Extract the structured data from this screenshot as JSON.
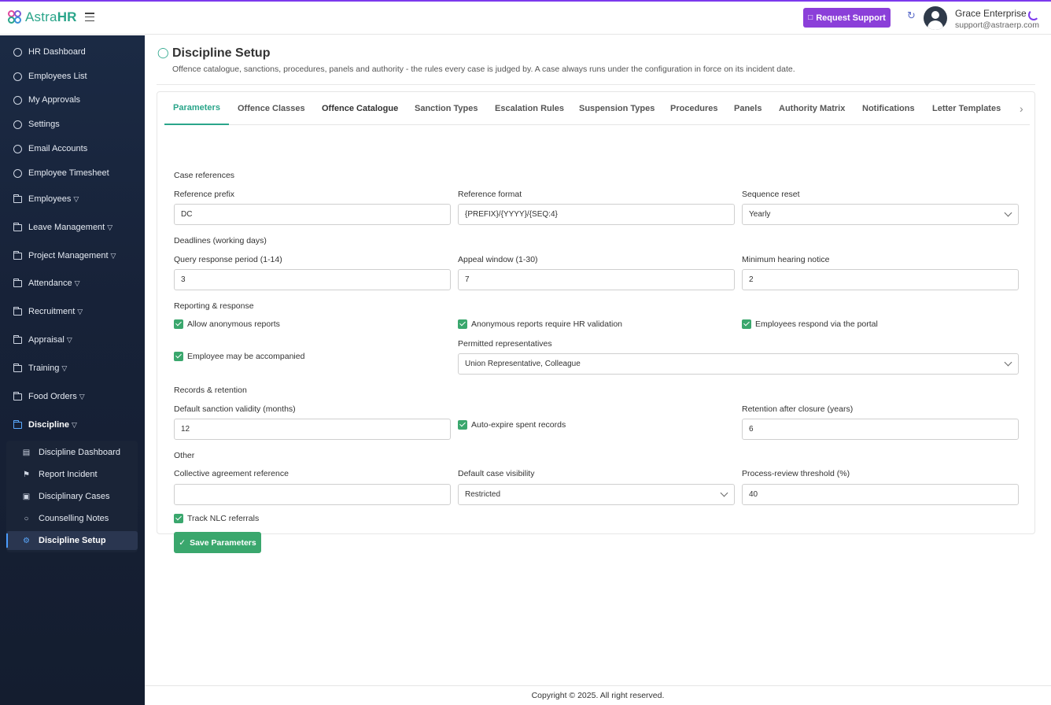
{
  "app": {
    "brand_light": "Astra",
    "brand_bold": "HR"
  },
  "header": {
    "support_label": "Request Support",
    "user_name": "Grace Enterprise",
    "user_email": "support@astraerp.com"
  },
  "sidebar": {
    "items": [
      {
        "label": "HR Dashboard"
      },
      {
        "label": "Employees List"
      },
      {
        "label": "My Approvals"
      },
      {
        "label": "Settings"
      },
      {
        "label": "Email Accounts"
      },
      {
        "label": "Employee Timesheet"
      },
      {
        "label": "Employees"
      },
      {
        "label": "Leave Management"
      },
      {
        "label": "Project Management"
      },
      {
        "label": "Attendance"
      },
      {
        "label": "Recruitment"
      },
      {
        "label": "Appraisal"
      },
      {
        "label": "Training"
      },
      {
        "label": "Food Orders"
      },
      {
        "label": "Discipline"
      }
    ],
    "sub_items": [
      {
        "label": "Discipline Dashboard"
      },
      {
        "label": "Report Incident"
      },
      {
        "label": "Disciplinary Cases"
      },
      {
        "label": "Counselling Notes"
      },
      {
        "label": "Discipline Setup"
      }
    ]
  },
  "page": {
    "title": "Discipline Setup",
    "description": "Offence catalogue, sanctions, procedures, panels and authority - the rules every case is judged by. A case always runs under the configuration in force on its incident date."
  },
  "tabs": [
    {
      "label": "Parameters"
    },
    {
      "label": "Offence Classes"
    },
    {
      "label": "Offence Catalogue"
    },
    {
      "label": "Sanction Types"
    },
    {
      "label": "Escalation Rules"
    },
    {
      "label": "Suspension Types"
    },
    {
      "label": "Procedures"
    },
    {
      "label": "Panels"
    },
    {
      "label": "Authority Matrix"
    },
    {
      "label": "Notifications"
    },
    {
      "label": "Letter Templates"
    }
  ],
  "form": {
    "case_references": {
      "heading": "Case references",
      "prefix_label": "Reference prefix",
      "prefix_value": "DC",
      "format_label": "Reference format",
      "format_value": "{PREFIX}/{YYYY}/{SEQ:4}",
      "reset_label": "Sequence reset",
      "reset_value": "Yearly"
    },
    "deadlines": {
      "heading": "Deadlines (working days)",
      "query_label": "Query response period (1-14)",
      "query_value": "3",
      "appeal_label": "Appeal window (1-30)",
      "appeal_value": "7",
      "notice_label": "Minimum hearing notice",
      "notice_value": "2"
    },
    "reporting": {
      "heading": "Reporting & response",
      "anon_label": "Allow anonymous reports",
      "anon_hr_label": "Anonymous reports require HR validation",
      "portal_label": "Employees respond via the portal",
      "accompanied_label": "Employee may be accompanied",
      "reps_label": "Permitted representatives",
      "reps_value": "Union Representative, Colleague"
    },
    "records": {
      "heading": "Records & retention",
      "validity_label": "Default sanction validity (months)",
      "validity_value": "12",
      "autoexpire_label": "Auto-expire spent records",
      "retention_label": "Retention after closure (years)",
      "retention_value": "6"
    },
    "other": {
      "heading": "Other",
      "agreement_label": "Collective agreement reference",
      "agreement_value": "",
      "visibility_label": "Default case visibility",
      "visibility_value": "Restricted",
      "threshold_label": "Process-review threshold (%)",
      "threshold_value": "40",
      "nlc_label": "Track NLC referrals"
    },
    "save_label": "Save Parameters"
  },
  "footer": {
    "text": "Copyright © 2025. All right reserved."
  },
  "colors": {
    "accent": "#2aa58a",
    "brand_purple": "#8b3fd9",
    "sidebar_bg": "#172238",
    "check_green": "#3aa76d"
  }
}
